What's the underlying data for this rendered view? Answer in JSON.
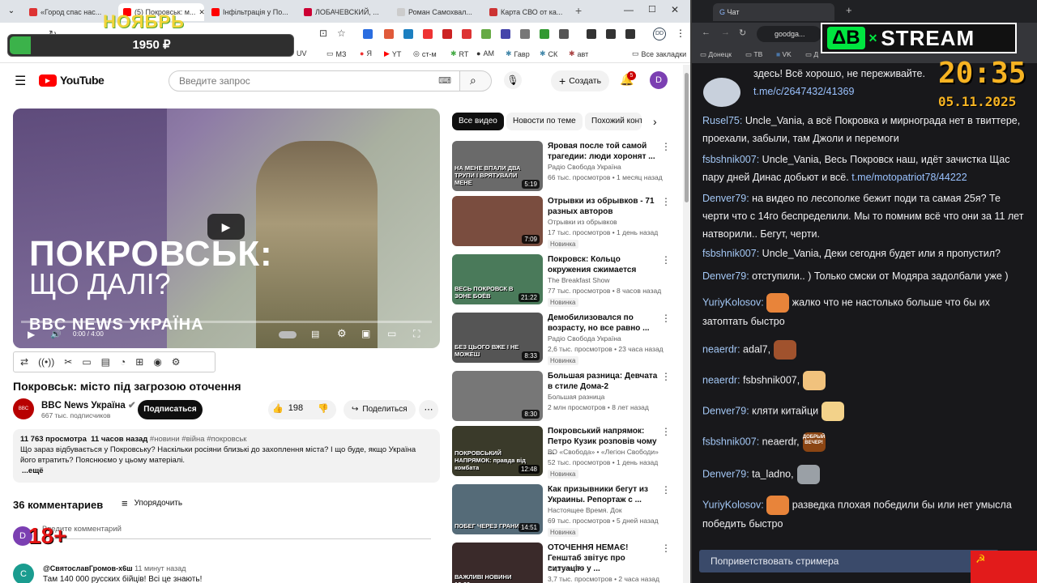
{
  "left_browser": {
    "tabs": [
      {
        "label": "«Город спас нас...",
        "color": "#d33"
      },
      {
        "label": "(5) Покровськ: м...",
        "color": "#f00"
      },
      {
        "label": "Інфільтрація у По...",
        "color": "#f00"
      },
      {
        "label": "ЛОБАЧЕВСКИЙ, ...",
        "color": "#c03"
      },
      {
        "label": "Роман Самохвал...",
        "color": "#888"
      },
      {
        "label": "Карта СВО от ка...",
        "color": "#c33"
      }
    ],
    "bookmarks": [
      "UV",
      "МЗ",
      "Я",
      "YT",
      "ст-м",
      "RT",
      "AM",
      "Гавр",
      "СК",
      "авт",
      "Все закладки"
    ]
  },
  "overlay": {
    "month": "НОЯБРЬ",
    "goal_amount": "1950 ₽",
    "age_badge": "18+",
    "brand_left": "ΔB",
    "brand_right": "STREAM",
    "clock": "20:35",
    "date": "05.11.2025"
  },
  "youtube": {
    "logo": "YouTube",
    "search_placeholder": "Введите запрос",
    "create_label": "Создать",
    "notif_count": "5",
    "avatar_letter": "D",
    "video": {
      "thumb_title_1": "ПОКРОВСЬК:",
      "thumb_title_2": "ЩО ДАЛІ?",
      "thumb_brand": "BBC NEWS УКРАЇНА",
      "time": "0:00 / 4:00",
      "title": "Покровськ: місто під загрозою оточення",
      "channel": "BBC News Україна",
      "subs": "667 тыс. подписчиков",
      "subscribe": "Подписаться",
      "likes": "198",
      "share": "Поделиться"
    },
    "description": {
      "views": "11 763 просмотра",
      "ago": "11 часов назад",
      "tags": "#новини #війна #покровськ",
      "text": "Що зараз відбувається у Покровську? Наскільки росіяни близькі до захоплення міста? І що буде, якщо Україна його втратить? Пояснюємо у цьому матеріалі.",
      "more": "...ещё"
    },
    "comments": {
      "count": "36 комментариев",
      "sort": "Упорядочить",
      "add": "Введите комментарий",
      "first_author": "@СвятославГромов-х6ш",
      "first_ago": "11 минут назад",
      "first_text": "Там 140 000 русских бійців! Всі це знають!"
    },
    "chips": [
      "Все видео",
      "Новости по теме",
      "Похожий конт"
    ],
    "related": [
      {
        "title": "Яровая после той самой трагедии: люди хоронят ...",
        "channel": "Радіо Свобода Україна",
        "meta": "66 тыс. просмотров • 1 месяц назад",
        "duration": "5:19",
        "badge": "",
        "thumb": "НА МЕНЕ ВПАЛИ ДВА ТРУПИ І ВРЯТУВАЛИ МЕНЕ"
      },
      {
        "title": "Отрывки из обрывков - 71 разных авторов",
        "channel": "Отрывки из обрывков",
        "meta": "17 тыс. просмотров • 1 день назад",
        "duration": "7:09",
        "badge": "Новинка",
        "thumb": ""
      },
      {
        "title": "Покровск: Кольцо окружения сжимается",
        "channel": "The Breakfast Show",
        "meta": "77 тыс. просмотров • 8 часов назад",
        "duration": "21:22",
        "badge": "Новинка",
        "thumb": "ВЕСЬ ПОКРОВСК В ЗОНЕ БОЁВ"
      },
      {
        "title": "Демобилизовался по возрасту, но все равно ...",
        "channel": "Радіо Свобода Україна",
        "meta": "2,6 тыс. просмотров • 23 часа назад",
        "duration": "8:33",
        "badge": "Новинка",
        "thumb": "БЕЗ ЦЬОГО ВЖЕ І НЕ МОЖЕШ"
      },
      {
        "title": "Большая разница: Девчата в стиле Дома-2",
        "channel": "Большая разница",
        "meta": "2 млн просмотров • 8 лет назад",
        "duration": "8:30",
        "badge": "",
        "thumb": ""
      },
      {
        "title": "Покровський напрямок: Петро Кузик розповів чому ...",
        "channel": "ВО «Свобода» • «Легіон Свободи»",
        "meta": "52 тыс. просмотров • 1 день назад",
        "duration": "12:48",
        "badge": "Новинка",
        "thumb": "ПОКРОВСЬКИЙ НАПРЯМОК: правда від комбата"
      },
      {
        "title": "Как призывники бегут из Украины. Репортаж с ...",
        "channel": "Настоящее Время. Док",
        "meta": "69 тыс. просмотров • 5 дней назад",
        "duration": "14:51",
        "badge": "Новинка",
        "thumb": "ПОБЕГ ЧЕРЕЗ ГРАНИЦУ"
      },
      {
        "title": "ОТОЧЕННЯ НЕМАЄ! Генштаб звітує про ситуацію у ...",
        "channel": "Espreso.TV",
        "meta": "3,7 тыс. просмотров • 2 часа назад",
        "duration": "",
        "badge": "",
        "thumb": "ВАЖЛИВІ НОВИНИ 16:00"
      }
    ]
  },
  "right_browser": {
    "tab_title": "Чат",
    "address": "goodga...",
    "bookmarks": [
      "Донецк",
      "ТВ",
      "VK",
      "Д"
    ]
  },
  "chat": {
    "messages": [
      {
        "nick": "",
        "text": "здесь! Всё хорошо, не переживайте. ",
        "link": "t.me/c/2647432/41369"
      },
      {
        "nick": "Rusel75:",
        "text": "Uncle_Vania, а всё Покровка и мирнограда нет в твиттере, проехали, забыли, там Джоли и перемоги",
        "link": ""
      },
      {
        "nick": "fsbshnik007:",
        "text": "Uncle_Vania, Весь Покровск наш, идёт зачистка Щас пару дней Динас добьют и всё. ",
        "link": "t.me/motopatriot78/44222"
      },
      {
        "nick": "Denver79:",
        "text": "на видео по лесополке бежит поди та самая 25я? Те черти что с 14го беспределили. Мы то помним всё что они за 11 лет натворили.. Бегут, черти.",
        "link": ""
      },
      {
        "nick": "fsbshnik007:",
        "text": "Uncle_Vania, Деки сегодня будет или я пропустил?",
        "link": ""
      },
      {
        "nick": "Denver79:",
        "text": "отступили.. ) Только смски от Модяра задолбали уже )",
        "link": ""
      },
      {
        "nick": "YuriyKolosov:",
        "text": "жалко что не настолько больше что бы их затоптать быстро",
        "link": ""
      },
      {
        "nick": "neaerdr:",
        "text": "adal7,",
        "link": ""
      },
      {
        "nick": "neaerdr:",
        "text": "fsbshnik007,",
        "link": ""
      },
      {
        "nick": "Denver79:",
        "text": "кляти китайци",
        "link": ""
      },
      {
        "nick": "fsbshnik007:",
        "text": "neaerdr,",
        "link": ""
      },
      {
        "nick": "Denver79:",
        "text": "ta_ladno,",
        "link": ""
      },
      {
        "nick": "YuriyKolosov:",
        "text": "разведка плохая победили бы или нет умысла победить быстро",
        "link": ""
      }
    ],
    "emote_text": "ДОБРЫЙ ВЕЧЕР!",
    "greet_button": "Поприветствовать стримера"
  }
}
